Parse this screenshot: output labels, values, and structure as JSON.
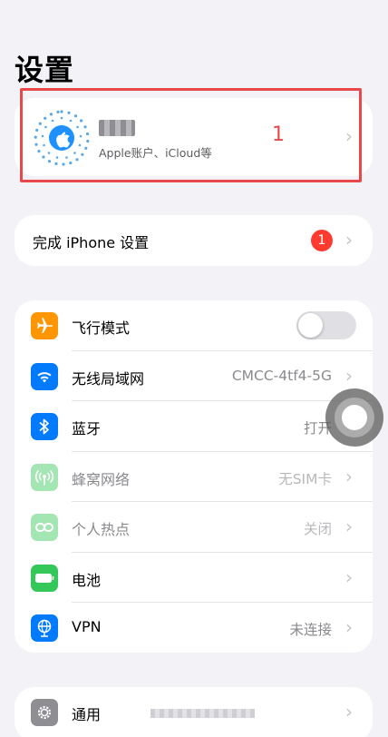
{
  "header": {
    "title": "设置"
  },
  "account": {
    "subtitle": "Apple账户、iCloud等",
    "annotation": "1",
    "chevron": "›"
  },
  "finish_setup": {
    "label": "完成 iPhone 设置",
    "badge": "1",
    "chevron": "›"
  },
  "settings": [
    {
      "key": "airplane",
      "label": "飞行模式",
      "value": "",
      "icon": "airplane-icon",
      "color": "#ff9500",
      "toggle": false
    },
    {
      "key": "wifi",
      "label": "无线局域网",
      "value": "CMCC-4tf4-5G",
      "icon": "wifi-icon",
      "color": "#007aff"
    },
    {
      "key": "bluetooth",
      "label": "蓝牙",
      "value": "打开",
      "icon": "bluetooth-icon",
      "color": "#007aff"
    },
    {
      "key": "cellular",
      "label": "蜂窝网络",
      "value": "无SIM卡",
      "icon": "cellular-icon",
      "color": "#34c759"
    },
    {
      "key": "hotspot",
      "label": "个人热点",
      "value": "关闭",
      "icon": "hotspot-icon",
      "color": "#34c759"
    },
    {
      "key": "battery",
      "label": "电池",
      "value": "",
      "icon": "battery-icon",
      "color": "#34c759"
    },
    {
      "key": "vpn",
      "label": "VPN",
      "value": "未连接",
      "icon": "vpn-icon",
      "color": "#007aff"
    }
  ],
  "general": {
    "label": "通用",
    "icon": "gear-icon",
    "color": "#8e8e93",
    "chevron": "›"
  },
  "colors": {
    "accent": "#007aff",
    "highlight": "#e8484a",
    "badge": "#ff3b30"
  }
}
